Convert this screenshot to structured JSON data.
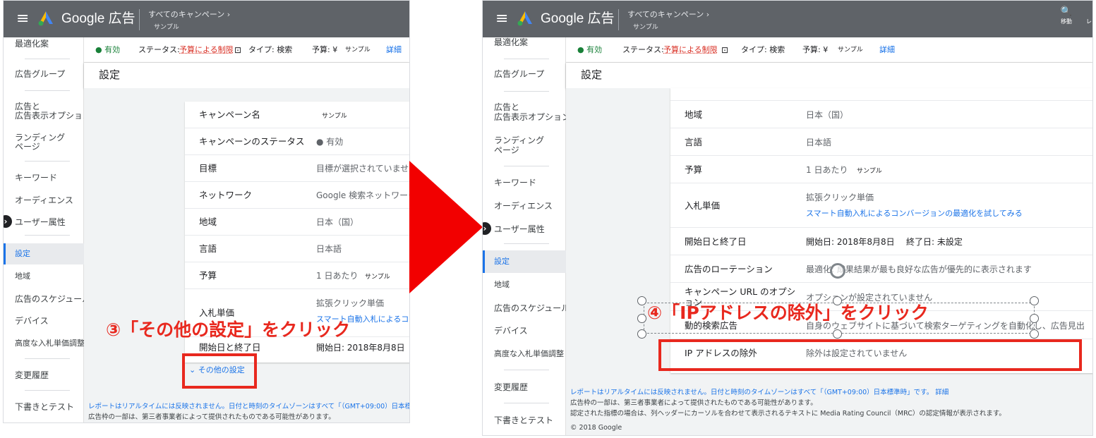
{
  "app": {
    "brand": "Google 広告",
    "breadcrumb": "すべてのキャンペーン",
    "breadcrumb_chevron": "›",
    "campaign": "サンプル"
  },
  "colors": {
    "accent": "#1a73e8",
    "annotation_red": "#e8281e",
    "header_gray": "#5f6368"
  },
  "sidebar_left": [
    "最適化案",
    "広告グループ",
    "広告と",
    "広告表示オプション",
    "ランディング",
    "ページ",
    "キーワード",
    "オーディエンス",
    "ユーザー属性",
    "設定",
    "地域",
    "広告のスケジュール",
    "デバイス",
    "高度な入札単価調整",
    "変更履歴",
    "下書きとテスト"
  ],
  "status": {
    "active": "● 有効",
    "status_label": "ステータス:",
    "status_value": "予算による制限",
    "type": "タイプ: 検索",
    "budget_label": "予算: ¥",
    "budget_value": "サンプル",
    "details": "詳細",
    "details_chevron": "⌄"
  },
  "page_title": "設定",
  "left_rows": [
    {
      "label": "キャンペーン名",
      "value": "サンプル"
    },
    {
      "label": "キャンペーンのステータス",
      "value": "● 有効"
    },
    {
      "label": "目標",
      "value": "目標が選択されていません"
    },
    {
      "label": "ネットワーク",
      "value": "Google 検索ネットワーク"
    },
    {
      "label": "地域",
      "value": "日本（国）"
    },
    {
      "label": "言語",
      "value": "日本語"
    },
    {
      "label": "予算",
      "value": "1 日あたり",
      "value2": "サンプル"
    },
    {
      "label": "入札単価",
      "value": "拡張クリック単価",
      "value2": "スマート自動入札によるコンバージョンの最適化を試してみる"
    },
    {
      "label": "開始日と終了日",
      "value": "開始日: 2018年8月8日"
    }
  ],
  "more_settings": "⌄ その他の設定",
  "annotation_left": "③「その他の設定」をクリック",
  "footer_left": [
    "レポートはリアルタイムには反映されません。日付と時刻のタイムゾーンはすべて「（GMT+09:00）日本標準時」です。",
    "広告枠の一部は、第三者事業者によって提供されたものである可能性があります。"
  ],
  "right_rows": [
    {
      "label": "地域",
      "value": "日本（国）"
    },
    {
      "label": "言語",
      "value": "日本語"
    },
    {
      "label": "予算",
      "value": "1 日あたり",
      "value2": "サンプル"
    },
    {
      "label": "入札単価",
      "value": "拡張クリック単価",
      "value2": "スマート自動入札によるコンバージョンの最適化を試してみる"
    },
    {
      "label": "開始日と終了日",
      "value": "開始日: 2018年8月8日",
      "value2": "終了日: 未設定"
    },
    {
      "label": "広告のローテーション",
      "value": "最適化: 成果結果が最も良好な広告が優先的に表示されます"
    },
    {
      "label": "キャンペーン URL のオプション",
      "value": "オプションが設定されていません"
    },
    {
      "label": "動的検索広告",
      "value": "自身のウェブサイトに基づいて検索ターゲティングを自動化し、広告見出"
    },
    {
      "label": "IP アドレスの除外",
      "value": "除外は設定されていません"
    }
  ],
  "annotation_right": "④「IPアドレスの除外」をクリック",
  "footer_right": [
    "レポートはリアルタイムには反映されません。日付と時刻のタイムゾーンはすべて「（GMT+09:00）日本標準時」です。",
    "詳細",
    "広告枠の一部は、第三者事業者によって提供されたものである可能性があります。",
    "認定された指標の場合は、列ヘッダーにカーソルを合わせて表示されるテキストに Media Rating Council（MRC）の認定情報が表示されます。",
    "© 2018 Google"
  ],
  "top_icons": {
    "search_glyph": "🔍",
    "search_label": "移動",
    "extra_label": "レ"
  }
}
